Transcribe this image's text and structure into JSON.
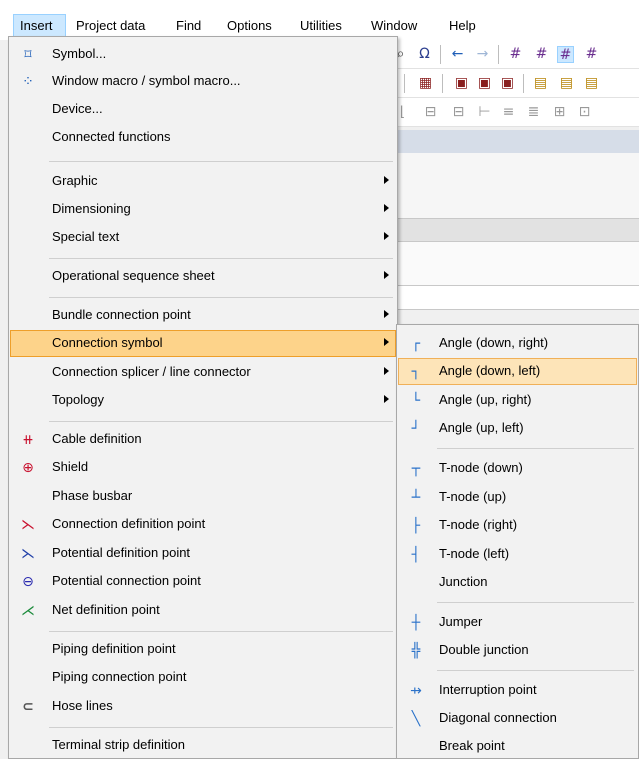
{
  "menubar": {
    "items": [
      {
        "label": "Insert",
        "active": true
      },
      {
        "label": "Project data"
      },
      {
        "label": "Find"
      },
      {
        "label": "Options"
      },
      {
        "label": "Utilities"
      },
      {
        "label": "Window"
      },
      {
        "label": "Help"
      }
    ]
  },
  "main_menu": {
    "items": [
      {
        "label": "Symbol...",
        "icon": "symbol-icon",
        "glyph": "⌑",
        "color": "#1f5fb8"
      },
      {
        "label": "Window macro / symbol macro...",
        "icon": "window-macro-icon",
        "glyph": "⁘",
        "color": "#1f5fb8"
      },
      {
        "label": "Device..."
      },
      {
        "label": "Connected functions"
      },
      {
        "label": "Graphic",
        "submenu": true
      },
      {
        "label": "Dimensioning",
        "submenu": true
      },
      {
        "label": "Special text",
        "submenu": true
      },
      {
        "label": "Operational sequence sheet",
        "submenu": true
      },
      {
        "label": "Bundle connection point",
        "submenu": true
      },
      {
        "label": "Connection symbol",
        "submenu": true,
        "highlighted": true
      },
      {
        "label": "Connection splicer / line connector",
        "submenu": true
      },
      {
        "label": "Topology",
        "submenu": true
      },
      {
        "label": "Cable definition",
        "icon": "cable-definition-icon",
        "glyph": "⧺",
        "color": "#c8102e"
      },
      {
        "label": "Shield",
        "icon": "shield-icon",
        "glyph": "⊕",
        "color": "#c8102e"
      },
      {
        "label": "Phase busbar"
      },
      {
        "label": "Connection definition point",
        "icon": "connection-definition-point-icon",
        "glyph": "⋋",
        "color": "#c8102e"
      },
      {
        "label": "Potential definition point",
        "icon": "potential-definition-point-icon",
        "glyph": "⋋",
        "color": "#1f3fa8"
      },
      {
        "label": "Potential connection point",
        "icon": "potential-connection-point-icon",
        "glyph": "⊖",
        "color": "#2a2ab0"
      },
      {
        "label": "Net definition point",
        "icon": "net-definition-point-icon",
        "glyph": "⋌",
        "color": "#1a8a3a"
      },
      {
        "label": "Piping definition point"
      },
      {
        "label": "Piping connection point"
      },
      {
        "label": "Hose lines",
        "icon": "hose-lines-icon",
        "glyph": "⊂",
        "color": "#555555"
      },
      {
        "label": "Terminal strip definition"
      }
    ]
  },
  "sub_menu": {
    "items": [
      {
        "label": "Angle (down, right)",
        "icon": "angle-down-right-icon",
        "glyph": "┌"
      },
      {
        "label": "Angle (down, left)",
        "icon": "angle-down-left-icon",
        "glyph": "┐",
        "highlighted": true
      },
      {
        "label": "Angle (up, right)",
        "icon": "angle-up-right-icon",
        "glyph": "└"
      },
      {
        "label": "Angle (up, left)",
        "icon": "angle-up-left-icon",
        "glyph": "┘"
      },
      {
        "label": "T-node (down)",
        "icon": "t-node-down-icon",
        "glyph": "┬"
      },
      {
        "label": "T-node (up)",
        "icon": "t-node-up-icon",
        "glyph": "┴"
      },
      {
        "label": "T-node (right)",
        "icon": "t-node-right-icon",
        "glyph": "├"
      },
      {
        "label": "T-node (left)",
        "icon": "t-node-left-icon",
        "glyph": "┤"
      },
      {
        "label": "Junction"
      },
      {
        "label": "Jumper",
        "icon": "jumper-icon",
        "glyph": "┼"
      },
      {
        "label": "Double junction",
        "icon": "double-junction-icon",
        "glyph": "╬"
      },
      {
        "label": "Interruption point",
        "icon": "interruption-point-icon",
        "glyph": "⇸"
      },
      {
        "label": "Diagonal connection",
        "icon": "diagonal-connection-icon",
        "glyph": "╲"
      },
      {
        "label": "Break point"
      }
    ]
  },
  "colors": {
    "highlight": "#fdd38a",
    "highlight_border": "#ee9f2a",
    "submenu_highlight": "#fde4b8",
    "connector_icon": "#2b72c9",
    "connector_dot": "#e8a020"
  }
}
